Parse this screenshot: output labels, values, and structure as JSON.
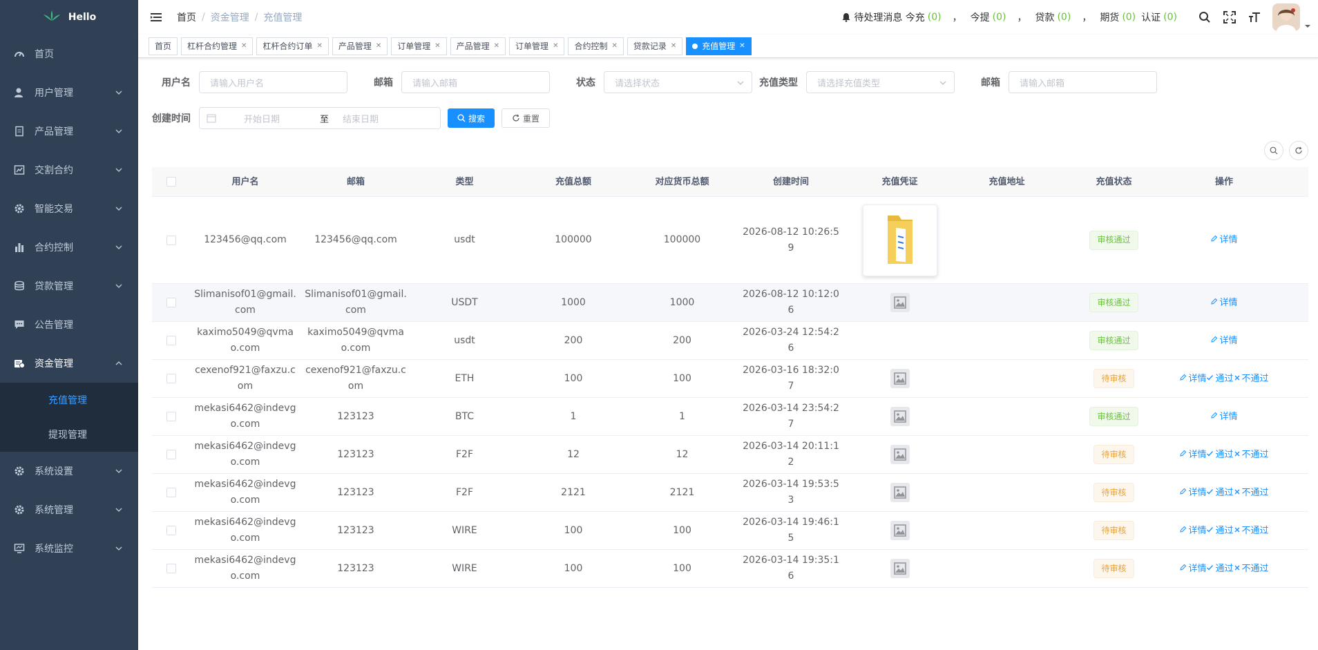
{
  "app": {
    "logo_text": "Hello"
  },
  "sidebar": {
    "items": [
      {
        "label": "首页",
        "icon": "dashboard-icon",
        "expandable": false
      },
      {
        "label": "用户管理",
        "icon": "user-icon",
        "expandable": true
      },
      {
        "label": "产品管理",
        "icon": "document-icon",
        "expandable": true
      },
      {
        "label": "交割合约",
        "icon": "chart-edit-icon",
        "expandable": true
      },
      {
        "label": "智能交易",
        "icon": "gear-icon",
        "expandable": true
      },
      {
        "label": "合约控制",
        "icon": "bar-chart-icon",
        "expandable": true
      },
      {
        "label": "贷款管理",
        "icon": "money-icon",
        "expandable": true
      },
      {
        "label": "公告管理",
        "icon": "message-icon",
        "expandable": false
      },
      {
        "label": "资金管理",
        "icon": "fund-icon",
        "expandable": true,
        "open": true
      },
      {
        "label": "系统设置",
        "icon": "gear-icon",
        "expandable": true
      },
      {
        "label": "系统管理",
        "icon": "gear-icon",
        "expandable": true
      },
      {
        "label": "系统监控",
        "icon": "monitor-icon",
        "expandable": true
      }
    ],
    "submenu": [
      {
        "label": "充值管理",
        "active": true
      },
      {
        "label": "提现管理",
        "active": false
      }
    ]
  },
  "breadcrumb": [
    "首页",
    "资金管理",
    "充值管理"
  ],
  "notice": {
    "label": "待处理消息 今充",
    "recharge_count": "(0)",
    "withdraw_label": "今提",
    "withdraw_count": "(0)",
    "loan_label": "贷款",
    "loan_count": "(0)",
    "futures_label": "期货",
    "futures_count": "(0)",
    "auth_label": "认证",
    "auth_count": "(0)",
    "sep": "，"
  },
  "tags": [
    {
      "label": "首页",
      "closable": false
    },
    {
      "label": "杠杆合约管理",
      "closable": true
    },
    {
      "label": "杠杆合约订单",
      "closable": true
    },
    {
      "label": "产品管理",
      "closable": true
    },
    {
      "label": "订单管理",
      "closable": true
    },
    {
      "label": "产品管理",
      "closable": true
    },
    {
      "label": "订单管理",
      "closable": true
    },
    {
      "label": "合约控制",
      "closable": true
    },
    {
      "label": "贷款记录",
      "closable": true
    },
    {
      "label": "充值管理",
      "closable": true,
      "active": true
    }
  ],
  "search": {
    "username_label": "用户名",
    "username_placeholder": "请输入用户名",
    "email_label": "邮箱",
    "email_placeholder": "请输入邮箱",
    "status_label": "状态",
    "status_placeholder": "请选择状态",
    "type_label": "充值类型",
    "type_placeholder": "请选择充值类型",
    "email2_label": "邮箱",
    "email2_placeholder": "请输入邮箱",
    "created_label": "创建时间",
    "start_placeholder": "开始日期",
    "range_sep": "至",
    "end_placeholder": "结束日期",
    "search_button": "搜索",
    "reset_button": "重置"
  },
  "table": {
    "headers": [
      "用户名",
      "邮箱",
      "类型",
      "充值总额",
      "对应货币总额",
      "创建时间",
      "充值凭证",
      "充值地址",
      "充值状态",
      "操作"
    ],
    "rows": [
      {
        "username": "123456@qq.com",
        "email": "123456@qq.com",
        "type": "usdt",
        "amount": "100000",
        "currency_amount": "100000",
        "created": "2026-08-12 10:26:59",
        "voucher": "folder",
        "address": "",
        "status": "审核通过",
        "status_kind": "pass",
        "ops": [
          "详情"
        ]
      },
      {
        "username": "Slimanisof01@gmail.com",
        "email": "Slimanisof01@gmail.com",
        "type": "USDT",
        "amount": "1000",
        "currency_amount": "1000",
        "created": "2026-08-12 10:12:06",
        "voucher": "placeholder",
        "address": "",
        "status": "审核通过",
        "status_kind": "pass",
        "ops": [
          "详情"
        ]
      },
      {
        "username": "kaximo5049@qvmao.com",
        "email": "kaximo5049@qvmao.com",
        "type": "usdt",
        "amount": "200",
        "currency_amount": "200",
        "created": "2026-03-24 12:54:26",
        "voucher": "none",
        "address": "",
        "status": "审核通过",
        "status_kind": "pass",
        "ops": [
          "详情"
        ]
      },
      {
        "username": "cexenof921@faxzu.com",
        "email": "cexenof921@faxzu.com",
        "type": "ETH",
        "amount": "100",
        "currency_amount": "100",
        "created": "2026-03-16 18:32:07",
        "voucher": "placeholder",
        "address": "",
        "status": "待审核",
        "status_kind": "wait",
        "ops": [
          "详情",
          "通过",
          "不通过"
        ]
      },
      {
        "username": "mekasi6462@indevgo.com",
        "email": "123123",
        "type": "BTC",
        "amount": "1",
        "currency_amount": "1",
        "created": "2026-03-14 23:54:27",
        "voucher": "placeholder",
        "address": "",
        "status": "审核通过",
        "status_kind": "pass",
        "ops": [
          "详情"
        ]
      },
      {
        "username": "mekasi6462@indevgo.com",
        "email": "123123",
        "type": "F2F",
        "amount": "12",
        "currency_amount": "12",
        "created": "2026-03-14 20:11:12",
        "voucher": "placeholder",
        "address": "",
        "status": "待审核",
        "status_kind": "wait",
        "ops": [
          "详情",
          "通过",
          "不通过"
        ]
      },
      {
        "username": "mekasi6462@indevgo.com",
        "email": "123123",
        "type": "F2F",
        "amount": "2121",
        "currency_amount": "2121",
        "created": "2026-03-14 19:53:53",
        "voucher": "placeholder",
        "address": "",
        "status": "待审核",
        "status_kind": "wait",
        "ops": [
          "详情",
          "通过",
          "不通过"
        ]
      },
      {
        "username": "mekasi6462@indevgo.com",
        "email": "123123",
        "type": "WIRE",
        "amount": "100",
        "currency_amount": "100",
        "created": "2026-03-14 19:46:15",
        "voucher": "placeholder",
        "address": "",
        "status": "待审核",
        "status_kind": "wait",
        "ops": [
          "详情",
          "通过",
          "不通过"
        ]
      },
      {
        "username": "mekasi6462@indevgo.com",
        "email": "123123",
        "type": "WIRE",
        "amount": "100",
        "currency_amount": "100",
        "created": "2026-03-14 19:35:16",
        "voucher": "placeholder",
        "address": "",
        "status": "待审核",
        "status_kind": "wait",
        "ops": [
          "详情",
          "通过",
          "不通过"
        ]
      }
    ]
  },
  "colors": {
    "sidebar_bg": "#304156",
    "primary": "#1890ff",
    "pass": "#67c23a",
    "wait": "#e6a23c"
  }
}
